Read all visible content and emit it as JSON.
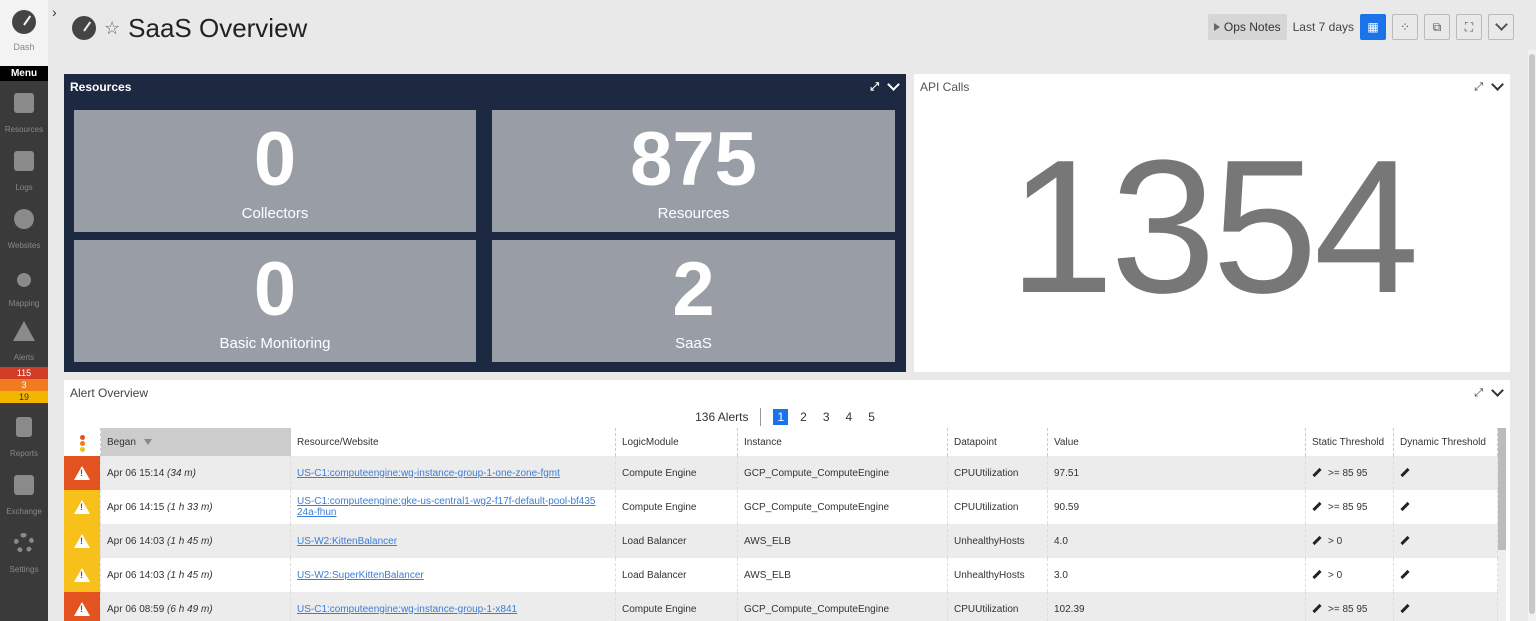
{
  "nav": {
    "dash_label": "Dash",
    "menu_label": "Menu",
    "items": [
      {
        "label": "Resources",
        "icon": "resources-icon"
      },
      {
        "label": "Logs",
        "icon": "logs-icon"
      },
      {
        "label": "Websites",
        "icon": "websites-icon"
      },
      {
        "label": "Mapping",
        "icon": "mapping-icon"
      },
      {
        "label": "Alerts",
        "icon": "alerts-icon"
      },
      {
        "label": "Reports",
        "icon": "reports-icon"
      },
      {
        "label": "Exchange",
        "icon": "exchange-icon"
      },
      {
        "label": "Settings",
        "icon": "settings-icon"
      }
    ],
    "alert_counts": {
      "critical": "115",
      "error": "3",
      "warning": "19"
    }
  },
  "header": {
    "title": "SaaS Overview",
    "star": "☆",
    "collapse": "›"
  },
  "toolbar": {
    "ops_notes": "Ops Notes",
    "range": "Last 7 days"
  },
  "widgets": {
    "resources": {
      "title": "Resources",
      "tiles": [
        {
          "value": "0",
          "label": "Collectors"
        },
        {
          "value": "875",
          "label": "Resources"
        },
        {
          "value": "0",
          "label": "Basic Monitoring"
        },
        {
          "value": "2",
          "label": "SaaS"
        }
      ]
    },
    "api_calls": {
      "title": "API Calls",
      "value": "1354"
    },
    "alert_overview": {
      "title": "Alert Overview",
      "count_label": "136 Alerts",
      "pages": [
        "1",
        "2",
        "3",
        "4",
        "5"
      ],
      "current_page": "1",
      "columns": [
        "Began",
        "Resource/Website",
        "LogicModule",
        "Instance",
        "Datapoint",
        "Value",
        "Static Threshold",
        "Dynamic Threshold"
      ],
      "rows": [
        {
          "severity": "critical",
          "began": "Apr 06 15:14",
          "dur": "(34 m)",
          "resource": "US-C1:computeengine:wg-instance-group-1-one-zone-fgmt",
          "module": "Compute Engine",
          "instance": "GCP_Compute_ComputeEngine",
          "datapoint": "CPUUtilization",
          "value": "97.51",
          "static": ">= 85 95"
        },
        {
          "severity": "warning",
          "began": "Apr 06 14:15",
          "dur": "(1 h 33 m)",
          "resource": "US-C1:computeengine:gke-us-central1-wg2-f17f-default-pool-bf43524a-fhun",
          "module": "Compute Engine",
          "instance": "GCP_Compute_ComputeEngine",
          "datapoint": "CPUUtilization",
          "value": "90.59",
          "static": ">= 85 95"
        },
        {
          "severity": "warning",
          "began": "Apr 06 14:03",
          "dur": "(1 h 45 m)",
          "resource": "US-W2:KittenBalancer",
          "module": "Load Balancer",
          "instance": "AWS_ELB",
          "datapoint": "UnhealthyHosts",
          "value": "4.0",
          "static": "> 0"
        },
        {
          "severity": "warning",
          "began": "Apr 06 14:03",
          "dur": "(1 h 45 m)",
          "resource": "US-W2:SuperKittenBalancer",
          "module": "Load Balancer",
          "instance": "AWS_ELB",
          "datapoint": "UnhealthyHosts",
          "value": "3.0",
          "static": "> 0"
        },
        {
          "severity": "critical",
          "began": "Apr 06 08:59",
          "dur": "(6 h 49 m)",
          "resource": "US-C1:computeengine:wg-instance-group-1-x841",
          "module": "Compute Engine",
          "instance": "GCP_Compute_ComputeEngine",
          "datapoint": "CPUUtilization",
          "value": "102.39",
          "static": ">= 85 95"
        }
      ]
    }
  },
  "colors": {
    "resources_bg": "#1d2841",
    "tile_bg": "#999ea6",
    "accent": "#1a73e8",
    "critical": "#e3531f",
    "warning": "#f7c01a"
  }
}
